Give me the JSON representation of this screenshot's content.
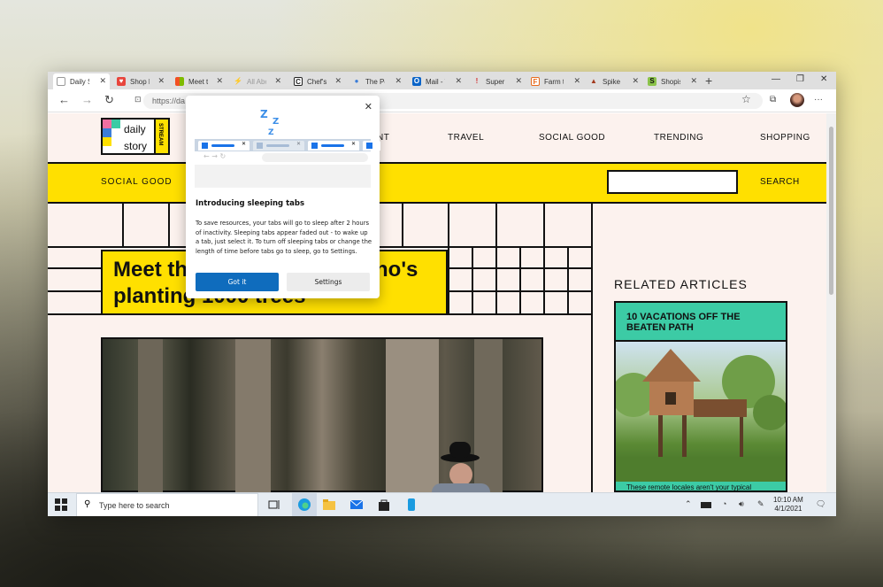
{
  "window": {
    "tabs": [
      {
        "title": "Daily Sto",
        "active": true,
        "favicon_color": "#f2c200"
      },
      {
        "title": "Shop Lo",
        "favicon_color": "#e8453c"
      },
      {
        "title": "Meet th",
        "favicon_color": "#00a4ef"
      },
      {
        "title": "All Abou",
        "favicon_color": "#9aa0a6"
      },
      {
        "title": "Chef's t",
        "favicon_color": "#222222"
      },
      {
        "title": "The Pet",
        "favicon_color": "#3b7dd8"
      },
      {
        "title": "Mail - T",
        "favicon_color": "#0a64c8"
      },
      {
        "title": "Super Sh",
        "favicon_color": "#d32f2f"
      },
      {
        "title": "Farm to",
        "favicon_color": "#e86a1c"
      },
      {
        "title": "Spike &",
        "favicon_color": "#a33a1e"
      },
      {
        "title": "Shopisi",
        "favicon_color": "#8bc34a"
      }
    ],
    "new_tab": "+",
    "controls": {
      "minimize": "—",
      "restore": "❐",
      "close": "✕"
    },
    "address": {
      "url": "https://da"
    },
    "icons": {
      "back": "←",
      "forward": "→",
      "reload": "↻",
      "lock": "🔒",
      "favorite": "☆",
      "collections": "⧉",
      "more": "···"
    }
  },
  "site": {
    "logo": {
      "word1": "daily",
      "word2": "story",
      "side": "STREAM"
    },
    "nav": [
      "NT",
      "TRAVEL",
      "SOCIAL GOOD",
      "TRENDING",
      "SHOPPING"
    ],
    "band": {
      "section": "SOCIAL GOOD",
      "search_button": "SEARCH",
      "search_value": ""
    },
    "headline": {
      "line1": "Meet th",
      "line1b": "ho's",
      "line2": "planting 1000 trees"
    },
    "related": {
      "heading": "RELATED ARTICLES",
      "card_title": "10 VACATIONS OFF THE BEATEN PATH",
      "card_snippet": "These remote locales aren't your typical"
    }
  },
  "popup": {
    "title": "Introducing sleeping tabs",
    "body": "To save resources, your tabs will go to sleep after 2 hours of inactivity. Sleeping tabs appear faded out - to wake up a tab, just select it. To turn off sleeping tabs or change the length of time before tabs go to sleep, go to Settings.",
    "primary_button": "Got it",
    "secondary_button": "Settings",
    "close": "✕",
    "z1": "Z",
    "z2": "Z",
    "z3": "Z"
  },
  "taskbar": {
    "search_placeholder": "Type here to search",
    "time": "10:10 AM",
    "date": "4/1/2021",
    "icons": [
      "windows-icon",
      "task-view-icon",
      "edge-icon",
      "file-explorer-icon",
      "mail-icon",
      "store-icon",
      "phone-icon"
    ]
  }
}
